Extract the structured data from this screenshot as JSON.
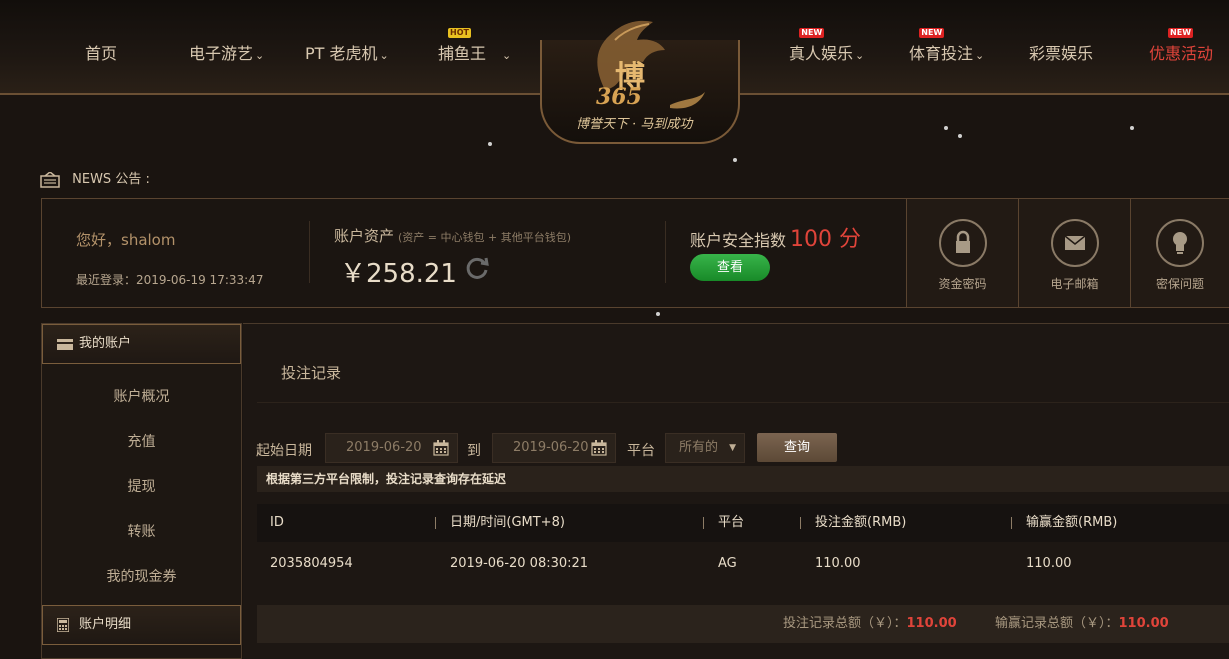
{
  "nav": {
    "left": [
      {
        "label": "首页",
        "chevron": false
      },
      {
        "label": "电子游艺",
        "chevron": true
      },
      {
        "label": "PT 老虎机",
        "chevron": true
      },
      {
        "label": "捕鱼王",
        "chevron": true,
        "badge": "HOT"
      }
    ],
    "right": [
      {
        "label": "真人娱乐",
        "chevron": true,
        "badge": "NEW"
      },
      {
        "label": "体育投注",
        "chevron": true,
        "badge": "NEW"
      },
      {
        "label": "彩票娱乐",
        "chevron": false
      },
      {
        "label": "优惠活动",
        "chevron": false,
        "badge": "NEW",
        "highlight": true
      }
    ],
    "chevron_glyph": "⌄"
  },
  "logo": {
    "cn": "博",
    "num": "365",
    "slogan": "博誉天下 · 马到成功"
  },
  "news": {
    "label": "NEWS 公告 :"
  },
  "account": {
    "greeting": "您好，shalom",
    "last_login": "最近登录：2019-06-19 17:33:47",
    "assets_label": "账户资产",
    "assets_note": "(资产 = 中心钱包 + 其他平台钱包)",
    "balance": "￥258.21",
    "security_label": "账户安全指数",
    "security_score": "100 分",
    "view_button": "查看",
    "quick_links": [
      {
        "label": "资金密码",
        "icon": "lock-icon"
      },
      {
        "label": "电子邮箱",
        "icon": "envelope-icon"
      },
      {
        "label": "密保问题",
        "icon": "lightbulb-icon"
      }
    ]
  },
  "sidebar": {
    "section1": "我的账户",
    "items": [
      "账户概况",
      "充值",
      "提现",
      "转账",
      "我的现金券"
    ],
    "section2": "账户明细"
  },
  "main": {
    "title": "投注记录",
    "filter": {
      "start_label": "起始日期",
      "start_value": "2019-06-20",
      "to_label": "到",
      "end_value": "2019-06-20",
      "platform_label": "平台",
      "platform_value": "所有的",
      "query_button": "查询"
    },
    "notice": "根据第三方平台限制，投注记录查询存在延迟",
    "columns": [
      "ID",
      "日期/时间(GMT+8)",
      "平台",
      "投注金额(RMB)",
      "输赢金额(RMB)"
    ],
    "rows": [
      [
        "2035804954",
        "2019-06-20 08:30:21",
        "AG",
        "110.00",
        "110.00"
      ]
    ],
    "totals": {
      "bet_label": "投注记录总额（￥）：",
      "bet_value": "110.00",
      "win_label": "输赢记录总额（￥）：",
      "win_value": "110.00"
    }
  },
  "colors": {
    "accent_gold": "#e2b66b",
    "alert_red": "#e0443a",
    "button_green": "#188a28"
  }
}
